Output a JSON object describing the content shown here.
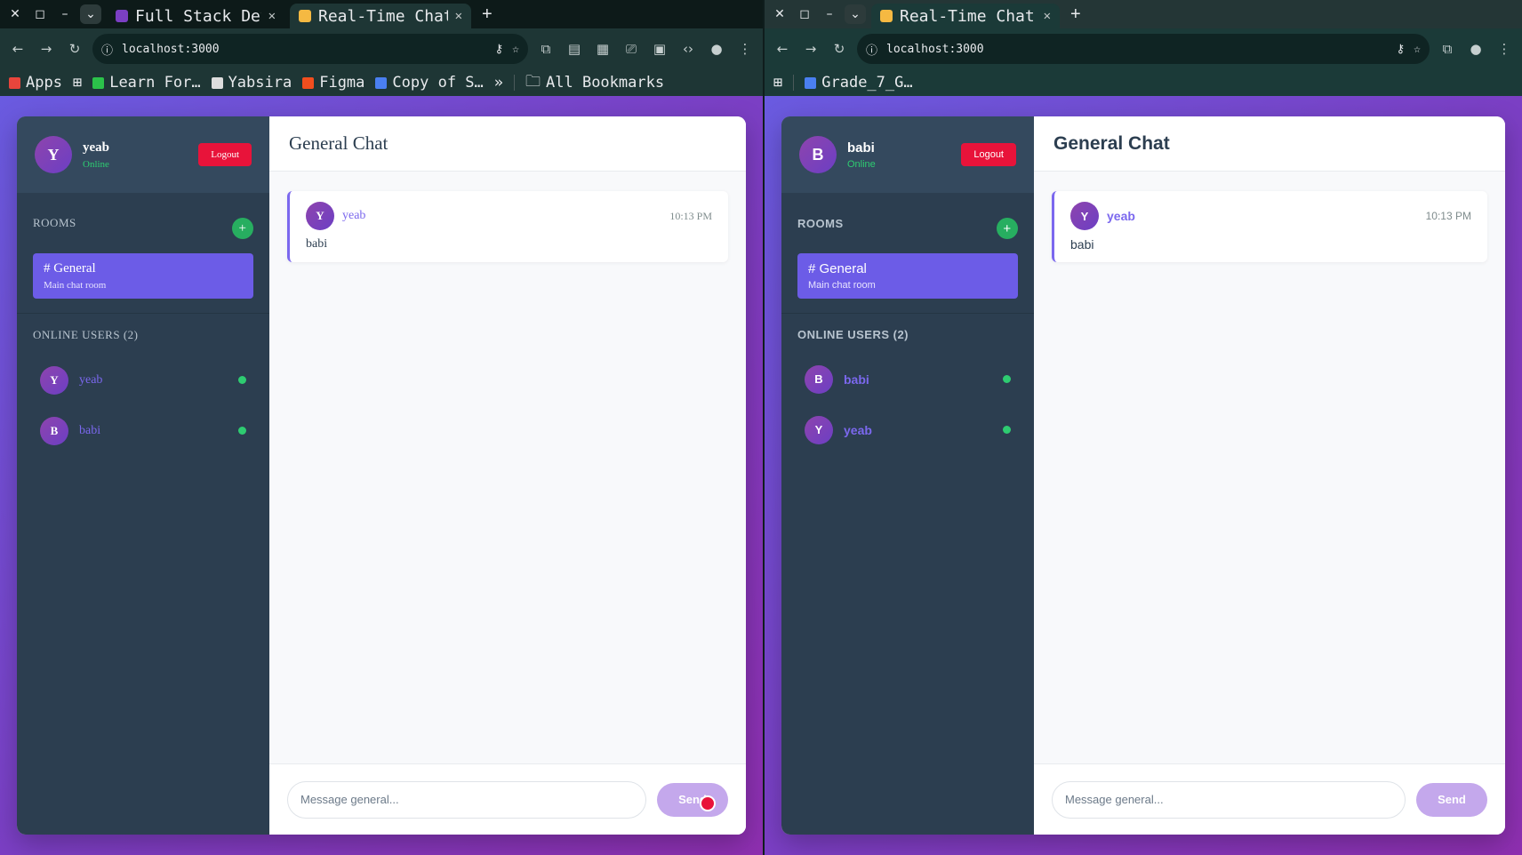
{
  "windows": [
    {
      "tabs": [
        {
          "title": "Full Stack Deve",
          "active": false,
          "favicon_color": "#7b3fc4"
        },
        {
          "title": "Real-Time Chat",
          "active": true,
          "favicon_color": "#f5b942"
        }
      ],
      "url": "localhost:3000",
      "bookmarks": [
        "Apps",
        "Learn For…",
        "Yabsira",
        "Figma",
        "Copy of S…",
        "All Bookmarks"
      ],
      "user": {
        "initial": "Y",
        "name": "yeab",
        "status": "Online"
      },
      "logout_label": "Logout",
      "rooms_heading": "ROOMS",
      "add_room": "+",
      "room": {
        "name": "# General",
        "desc": "Main chat room"
      },
      "online_heading": "ONLINE USERS (2)",
      "online_users": [
        {
          "initial": "Y",
          "name": "yeab"
        },
        {
          "initial": "B",
          "name": "babi"
        }
      ],
      "chat_title": "General Chat",
      "messages": [
        {
          "initial": "Y",
          "author": "yeab",
          "time": "10:13 PM",
          "text": "babi"
        }
      ],
      "input_placeholder": "Message general...",
      "send_label": "Send"
    },
    {
      "tabs": [
        {
          "title": "Real-Time Chat",
          "active": true,
          "favicon_color": "#f5b942"
        }
      ],
      "url": "localhost:3000",
      "bookmarks": [
        "Grade_7_G…"
      ],
      "user": {
        "initial": "B",
        "name": "babi",
        "status": "Online"
      },
      "logout_label": "Logout",
      "rooms_heading": "ROOMS",
      "add_room": "+",
      "room": {
        "name": "# General",
        "desc": "Main chat room"
      },
      "online_heading": "ONLINE USERS (2)",
      "online_users": [
        {
          "initial": "B",
          "name": "babi"
        },
        {
          "initial": "Y",
          "name": "yeab"
        }
      ],
      "chat_title": "General Chat",
      "messages": [
        {
          "initial": "Y",
          "author": "yeab",
          "time": "10:13 PM",
          "text": "babi"
        }
      ],
      "input_placeholder": "Message general...",
      "send_label": "Send"
    }
  ],
  "colors": {
    "accent": "#7b68ee",
    "logout": "#e8133a",
    "online": "#2ecc71",
    "sidebar": "#2c3e50"
  }
}
